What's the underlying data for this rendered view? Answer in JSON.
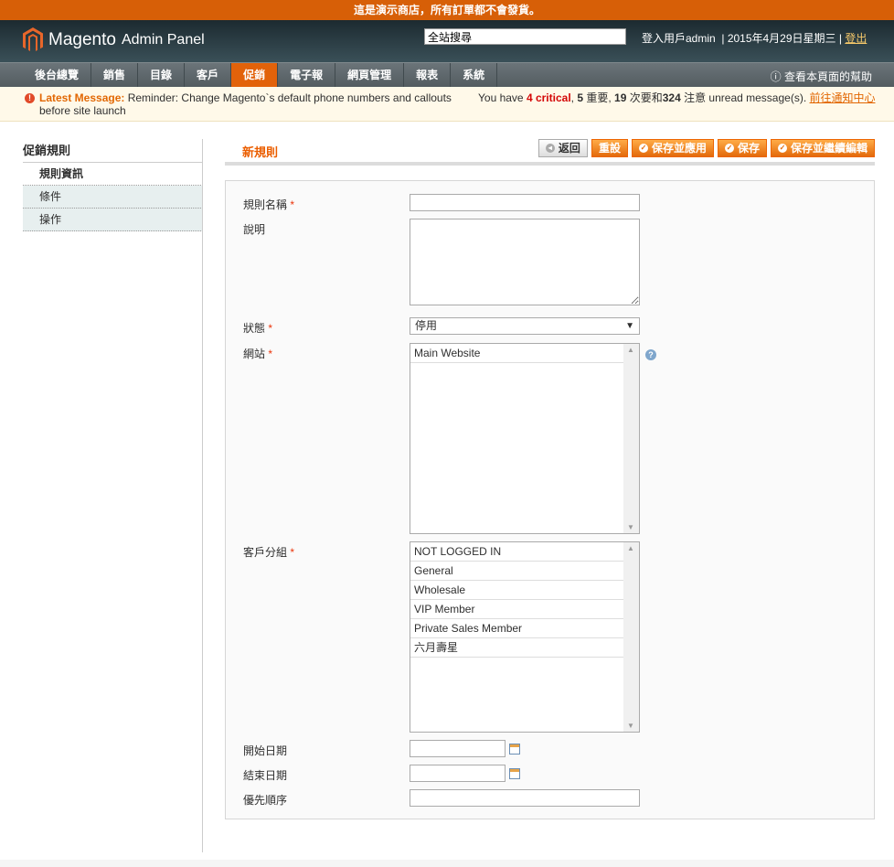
{
  "demo_notice": "這是演示商店，所有訂單都不會發貨。",
  "header": {
    "logo": "Magento",
    "logo_sub": "Admin Panel",
    "search_value": "全站搜尋",
    "logged_in": "登入用戶admin",
    "date": "2015年4月29日星期三",
    "logout": "登出"
  },
  "nav": {
    "items": [
      "後台總覽",
      "銷售",
      "目錄",
      "客戶",
      "促銷",
      "電子報",
      "網頁管理",
      "報表",
      "系統"
    ],
    "active": "促銷",
    "help": "查看本頁面的幫助"
  },
  "message": {
    "label": "Latest Message:",
    "text": "Reminder: Change Magento`s default phone numbers and callouts",
    "text2": "before site launch",
    "pre": "You have",
    "critical": "4 critical",
    "mid1": ", ",
    "major": "5",
    "major_label": " 重要, ",
    "minor": "19",
    "minor_label": " 次要和",
    "notice": "324",
    "notice_label": " 注意 unread message(s). ",
    "link": "前往通知中心"
  },
  "sidebar": {
    "title": "促銷規則",
    "items": [
      "規則資訊",
      "條件",
      "操作"
    ]
  },
  "page": {
    "title": "新規則",
    "buttons": {
      "back": "返回",
      "reset": "重設",
      "save_apply": "保存並應用",
      "save": "保存",
      "save_continue": "保存並繼續編輯"
    }
  },
  "form": {
    "name_label": "規則名稱",
    "name_value": "",
    "desc_label": "說明",
    "status_label": "狀態",
    "status_value": "停用",
    "website_label": "網站",
    "websites": [
      "Main Website"
    ],
    "group_label": "客戶分組",
    "groups": [
      "NOT LOGGED IN",
      "General",
      "Wholesale",
      "VIP Member",
      "Private Sales Member",
      "六月壽星"
    ],
    "from_label": "開始日期",
    "to_label": "結束日期",
    "priority_label": "優先順序"
  }
}
